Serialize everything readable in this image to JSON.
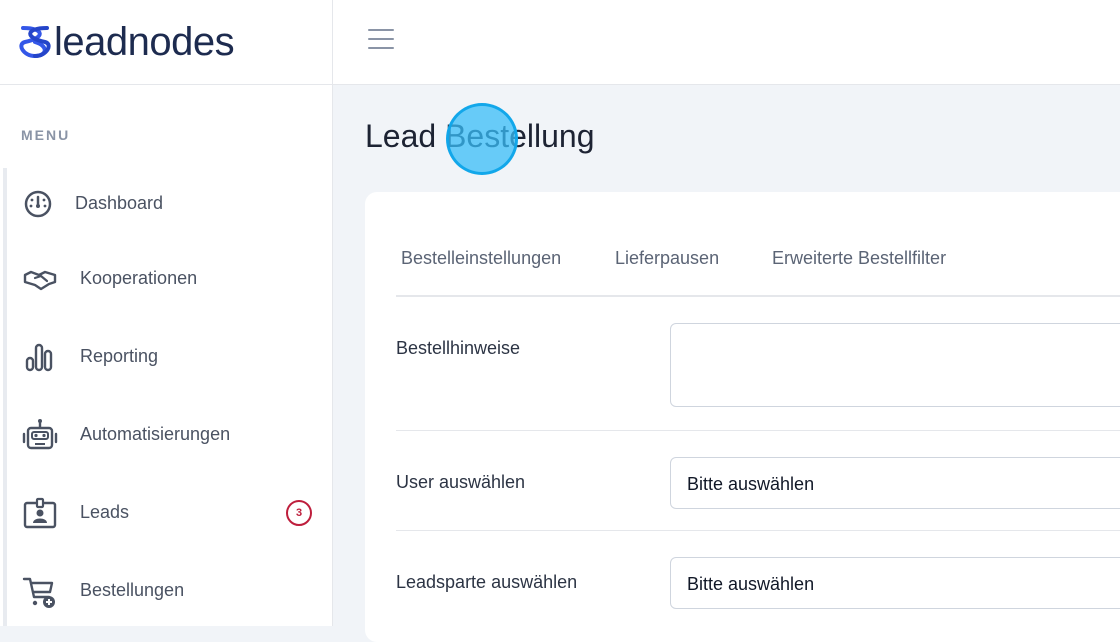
{
  "brand": {
    "name": "leadnodes",
    "logo_icon": "double-loop-logo-icon"
  },
  "sidebar": {
    "heading": "MENU",
    "items": [
      {
        "label": "Dashboard",
        "icon": "speedometer-icon"
      },
      {
        "label": "Kooperationen",
        "icon": "handshake-icon"
      },
      {
        "label": "Reporting",
        "icon": "bar-chart-icon"
      },
      {
        "label": "Automatisierungen",
        "icon": "robot-icon"
      },
      {
        "label": "Leads",
        "icon": "contact-card-icon",
        "badge": "3"
      },
      {
        "label": "Bestellungen",
        "icon": "cart-plus-icon"
      }
    ]
  },
  "topbar": {
    "menu_icon": "hamburger-icon"
  },
  "page": {
    "title": "Lead Bestellung"
  },
  "tabs": [
    {
      "label": "Bestelleinstellungen"
    },
    {
      "label": "Lieferpausen"
    },
    {
      "label": "Erweiterte Bestellfilter"
    }
  ],
  "form": {
    "notes_label": "Bestellhinweise",
    "notes_value": "",
    "user_label": "User auswählen",
    "user_value": "Bitte auswählen",
    "leadsparte_label": "Leadsparte auswählen",
    "leadsparte_value": "Bitte auswählen"
  },
  "colors": {
    "accent_badge": "#be1e3c",
    "brand_text": "#1d2b4f",
    "click_indicator": "#38bdf8"
  }
}
